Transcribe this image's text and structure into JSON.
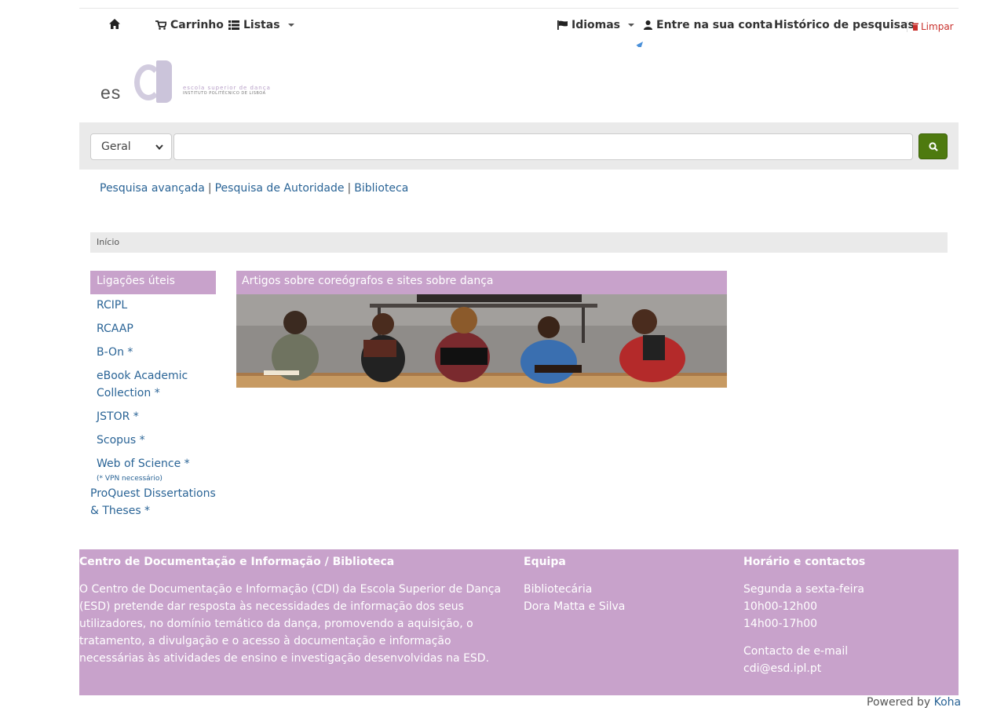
{
  "nav": {
    "cart_label": "Carrinho",
    "lists_label": "Listas",
    "languages_label": "Idiomas",
    "login_label": "Entre na sua conta",
    "history_label": "Histórico de pesquisas",
    "clear_label": "Limpar"
  },
  "logo": {
    "letters": "es",
    "line1": "escola superior de dança",
    "line2": "INSTITUTO POLITÉCNICO DE LISBOA"
  },
  "search": {
    "selected_index": "Geral",
    "query": "",
    "button_color": "#4e7a0f"
  },
  "links": {
    "advanced": "Pesquisa avançada",
    "authority": "Pesquisa de Autoridade",
    "library": "Biblioteca",
    "separator": "|"
  },
  "breadcrumb": {
    "home": "Início"
  },
  "sidebar": {
    "title": "Ligações úteis",
    "items": [
      "RCIPL",
      "RCAAP",
      "B-On *",
      "eBook Academic Collection *",
      "JSTOR *",
      "Scopus *",
      "Web of Science *"
    ],
    "note": "(* VPN necessário)",
    "extra": "ProQuest Dissertations & Theses *"
  },
  "article": {
    "title": "Artigos sobre coreógrafos e sites sobre dança"
  },
  "footer": {
    "col1_title": "Centro de Documentação e Informação / Biblioteca",
    "col1_text": "O Centro de Documentação e Informação (CDI) da Escola Superior de Dança (ESD) pretende dar resposta às necessidades de informação dos seus utilizadores, no domínio temático da dança, promovendo a aquisição, o tratamento, a divulgação e o acesso à documentação e informação necessárias às atividades de ensino e investigação desenvolvidas na ESD.",
    "col2_title": "Equipa",
    "col2_role": "Bibliotecária",
    "col2_name": "Dora Matta e Silva",
    "col3_title": "Horário e contactos",
    "col3_days": "Segunda a sexta-feira",
    "col3_hours1": "10h00-12h00",
    "col3_hours2": "14h00-17h00",
    "col3_contact_label": "Contacto de e-mail",
    "col3_email": "cdi@esd.ipl.pt"
  },
  "powered": {
    "prefix": "Powered by",
    "product": "Koha"
  },
  "colors": {
    "accent": "#c8a2cb",
    "link": "#2a6496"
  }
}
